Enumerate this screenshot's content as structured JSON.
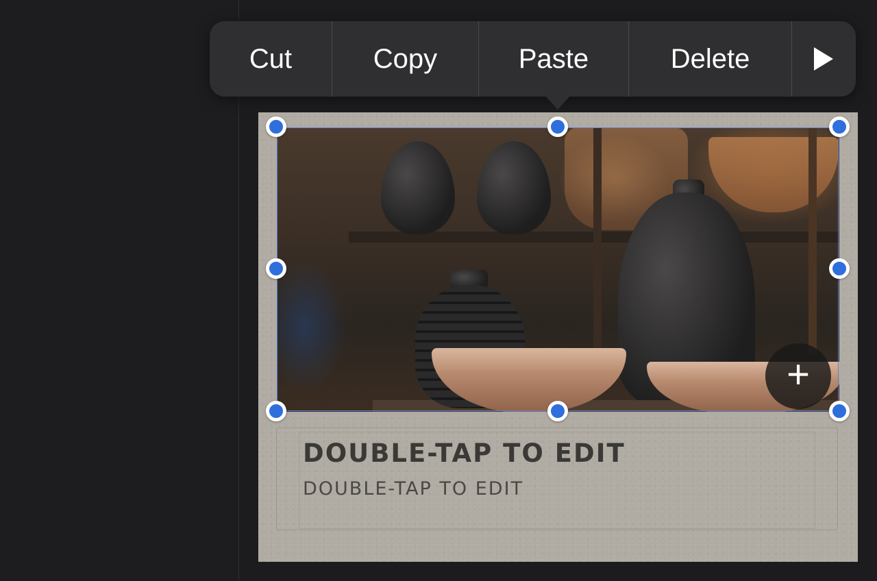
{
  "context_menu": {
    "items": [
      {
        "label": "Cut"
      },
      {
        "label": "Copy"
      },
      {
        "label": "Paste"
      },
      {
        "label": "Delete"
      }
    ],
    "more_icon": "play-triangle-icon"
  },
  "slide": {
    "title_placeholder": "DOUBLE-TAP TO EDIT",
    "subtitle_placeholder": "DOUBLE-TAP TO EDIT",
    "add_media_icon": "plus-icon"
  },
  "colors": {
    "handle": "#2f6fdc",
    "menu_bg": "#2f2f31",
    "slide_bg": "#b0aba3",
    "app_bg": "#1c1c1e"
  }
}
